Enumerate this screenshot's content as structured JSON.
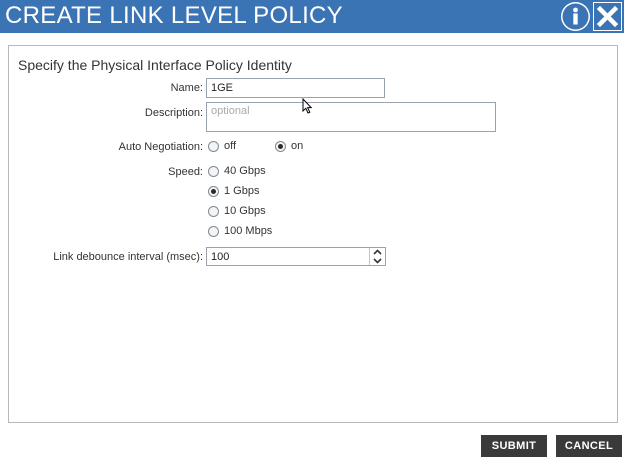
{
  "dialog": {
    "title": "CREATE LINK LEVEL POLICY",
    "icons": [
      "info-icon",
      "close-icon"
    ]
  },
  "form": {
    "section_title": "Specify the Physical Interface Policy Identity",
    "name": {
      "label": "Name:",
      "value": "1GE"
    },
    "description": {
      "label": "Description:",
      "placeholder": "optional"
    },
    "auto_negotiation": {
      "label": "Auto Negotiation:",
      "options": [
        "off",
        "on"
      ],
      "selected": "on"
    },
    "speed": {
      "label": "Speed:",
      "options": [
        "40 Gbps",
        "1 Gbps",
        "10 Gbps",
        "100 Mbps"
      ],
      "selected": "1 Gbps"
    },
    "debounce": {
      "label": "Link debounce interval (msec):",
      "value": "100"
    }
  },
  "footer": {
    "submit_label": "SUBMIT",
    "cancel_label": "CANCEL"
  },
  "colors": {
    "titlebar": "#3b74b5",
    "button": "#3a3a3a"
  }
}
